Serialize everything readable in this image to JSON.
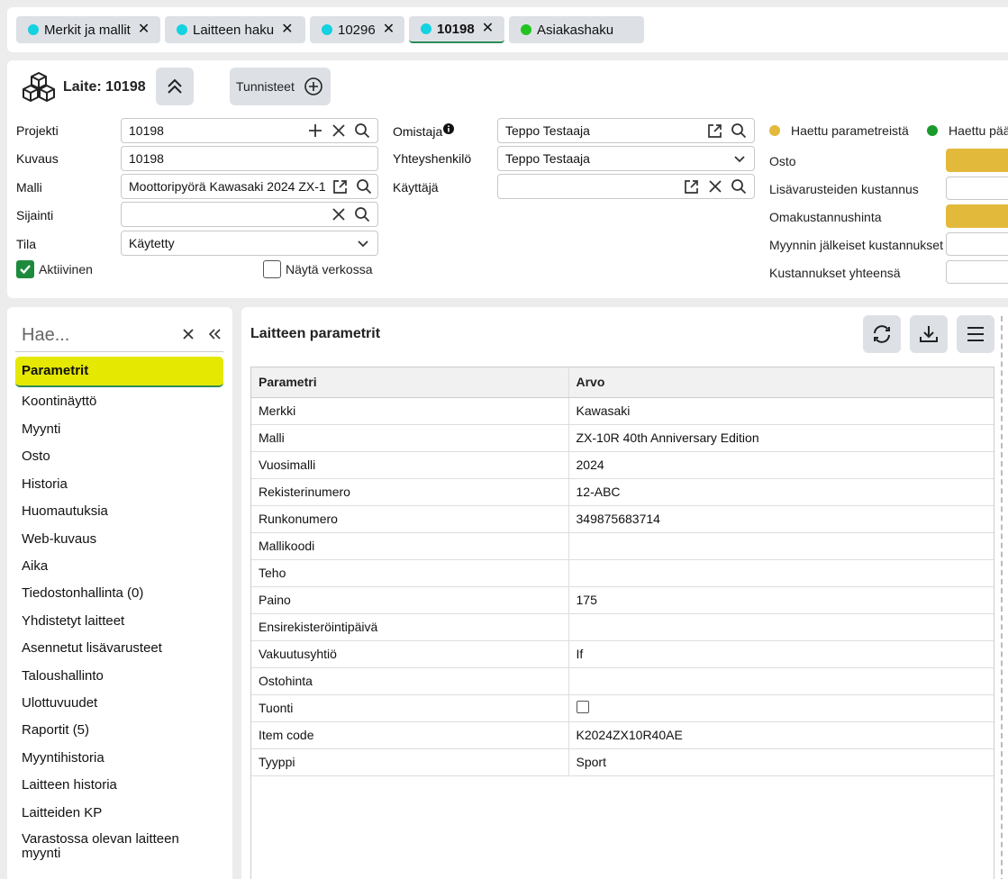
{
  "tabs": [
    {
      "label": "Merkit ja mallit",
      "dot_color": "#14d2e0",
      "active": false
    },
    {
      "label": "Laitteen haku",
      "dot_color": "#14d2e0",
      "active": false
    },
    {
      "label": "10296",
      "dot_color": "#14d2e0",
      "active": false
    },
    {
      "label": "10198",
      "dot_color": "#14d2e0",
      "active": true
    },
    {
      "label": "Asiakashaku",
      "dot_color": "#22c422",
      "active": false
    }
  ],
  "header": {
    "title": "Laite: 10198",
    "tags_button": "Tunnisteet",
    "fields": {
      "projekti": {
        "label": "Projekti",
        "value": "10198"
      },
      "kuvaus": {
        "label": "Kuvaus",
        "value": "10198"
      },
      "malli": {
        "label": "Malli",
        "value": "Moottoripyörä Kawasaki 2024 ZX-1"
      },
      "sijainti": {
        "label": "Sijainti",
        "value": ""
      },
      "tila": {
        "label": "Tila",
        "value": "Käytetty"
      },
      "omistaja": {
        "label": "Omistaja",
        "value": "Teppo Testaaja"
      },
      "yhteyshenkilo": {
        "label": "Yhteyshenkilö",
        "value": "Teppo Testaaja"
      },
      "kayttaja": {
        "label": "Käyttäjä",
        "value": ""
      }
    },
    "aktiivinen": {
      "label": "Aktiivinen",
      "checked": true
    },
    "nayta_verkossa": {
      "label": "Näytä verkossa",
      "checked": false
    },
    "legend": [
      {
        "label": "Haettu parametreistä",
        "color": "#e3b93b"
      },
      {
        "label": "Haettu pää",
        "color": "#1a9a2a"
      }
    ],
    "costs": [
      {
        "label": "Osto",
        "highlight": true
      },
      {
        "label": "Lisävarusteiden kustannus",
        "highlight": false
      },
      {
        "label": "Omakustannushinta",
        "highlight": true
      },
      {
        "label": "Myynnin jälkeiset kustannukset",
        "highlight": false
      },
      {
        "label": "Kustannukset yhteensä",
        "highlight": false
      }
    ]
  },
  "sidebar": {
    "search_placeholder": "Hae...",
    "items": [
      {
        "label": "Parametrit"
      },
      {
        "label": "Koontinäyttö"
      },
      {
        "label": "Myynti"
      },
      {
        "label": "Osto"
      },
      {
        "label": "Historia"
      },
      {
        "label": "Huomautuksia"
      },
      {
        "label": "Web-kuvaus"
      },
      {
        "label": "Aika"
      },
      {
        "label": "Tiedostonhallinta (0)"
      },
      {
        "label": "Yhdistetyt laitteet"
      },
      {
        "label": "Asennetut lisävarusteet"
      },
      {
        "label": "Taloushallinto"
      },
      {
        "label": "Ulottuvuudet"
      },
      {
        "label": "Raportit (5)"
      },
      {
        "label": "Myyntihistoria"
      },
      {
        "label": "Laitteen historia"
      },
      {
        "label": "Laitteiden KP"
      },
      {
        "label": "Varastossa olevan laitteen myynti"
      }
    ]
  },
  "main": {
    "title": "Laitteen parametrit",
    "columns": [
      "Parametri",
      "Arvo"
    ],
    "rows": [
      {
        "param": "Merkki",
        "value": "Kawasaki"
      },
      {
        "param": "Malli",
        "value": "ZX-10R 40th Anniversary Edition"
      },
      {
        "param": "Vuosimalli",
        "value": "2024"
      },
      {
        "param": "Rekisterinumero",
        "value": "12-ABC"
      },
      {
        "param": "Runkonumero",
        "value": "349875683714"
      },
      {
        "param": "Mallikoodi",
        "value": ""
      },
      {
        "param": "Teho",
        "value": ""
      },
      {
        "param": "Paino",
        "value": "175"
      },
      {
        "param": "Ensirekisteröintipäivä",
        "value": ""
      },
      {
        "param": "Vakuutusyhtiö",
        "value": "If"
      },
      {
        "param": "Ostohinta",
        "value": ""
      },
      {
        "param": "Tuonti",
        "value": "",
        "checkbox": true
      },
      {
        "param": "Item code",
        "value": "K2024ZX10R40AE"
      },
      {
        "param": "Tyyppi",
        "value": "Sport"
      }
    ]
  }
}
